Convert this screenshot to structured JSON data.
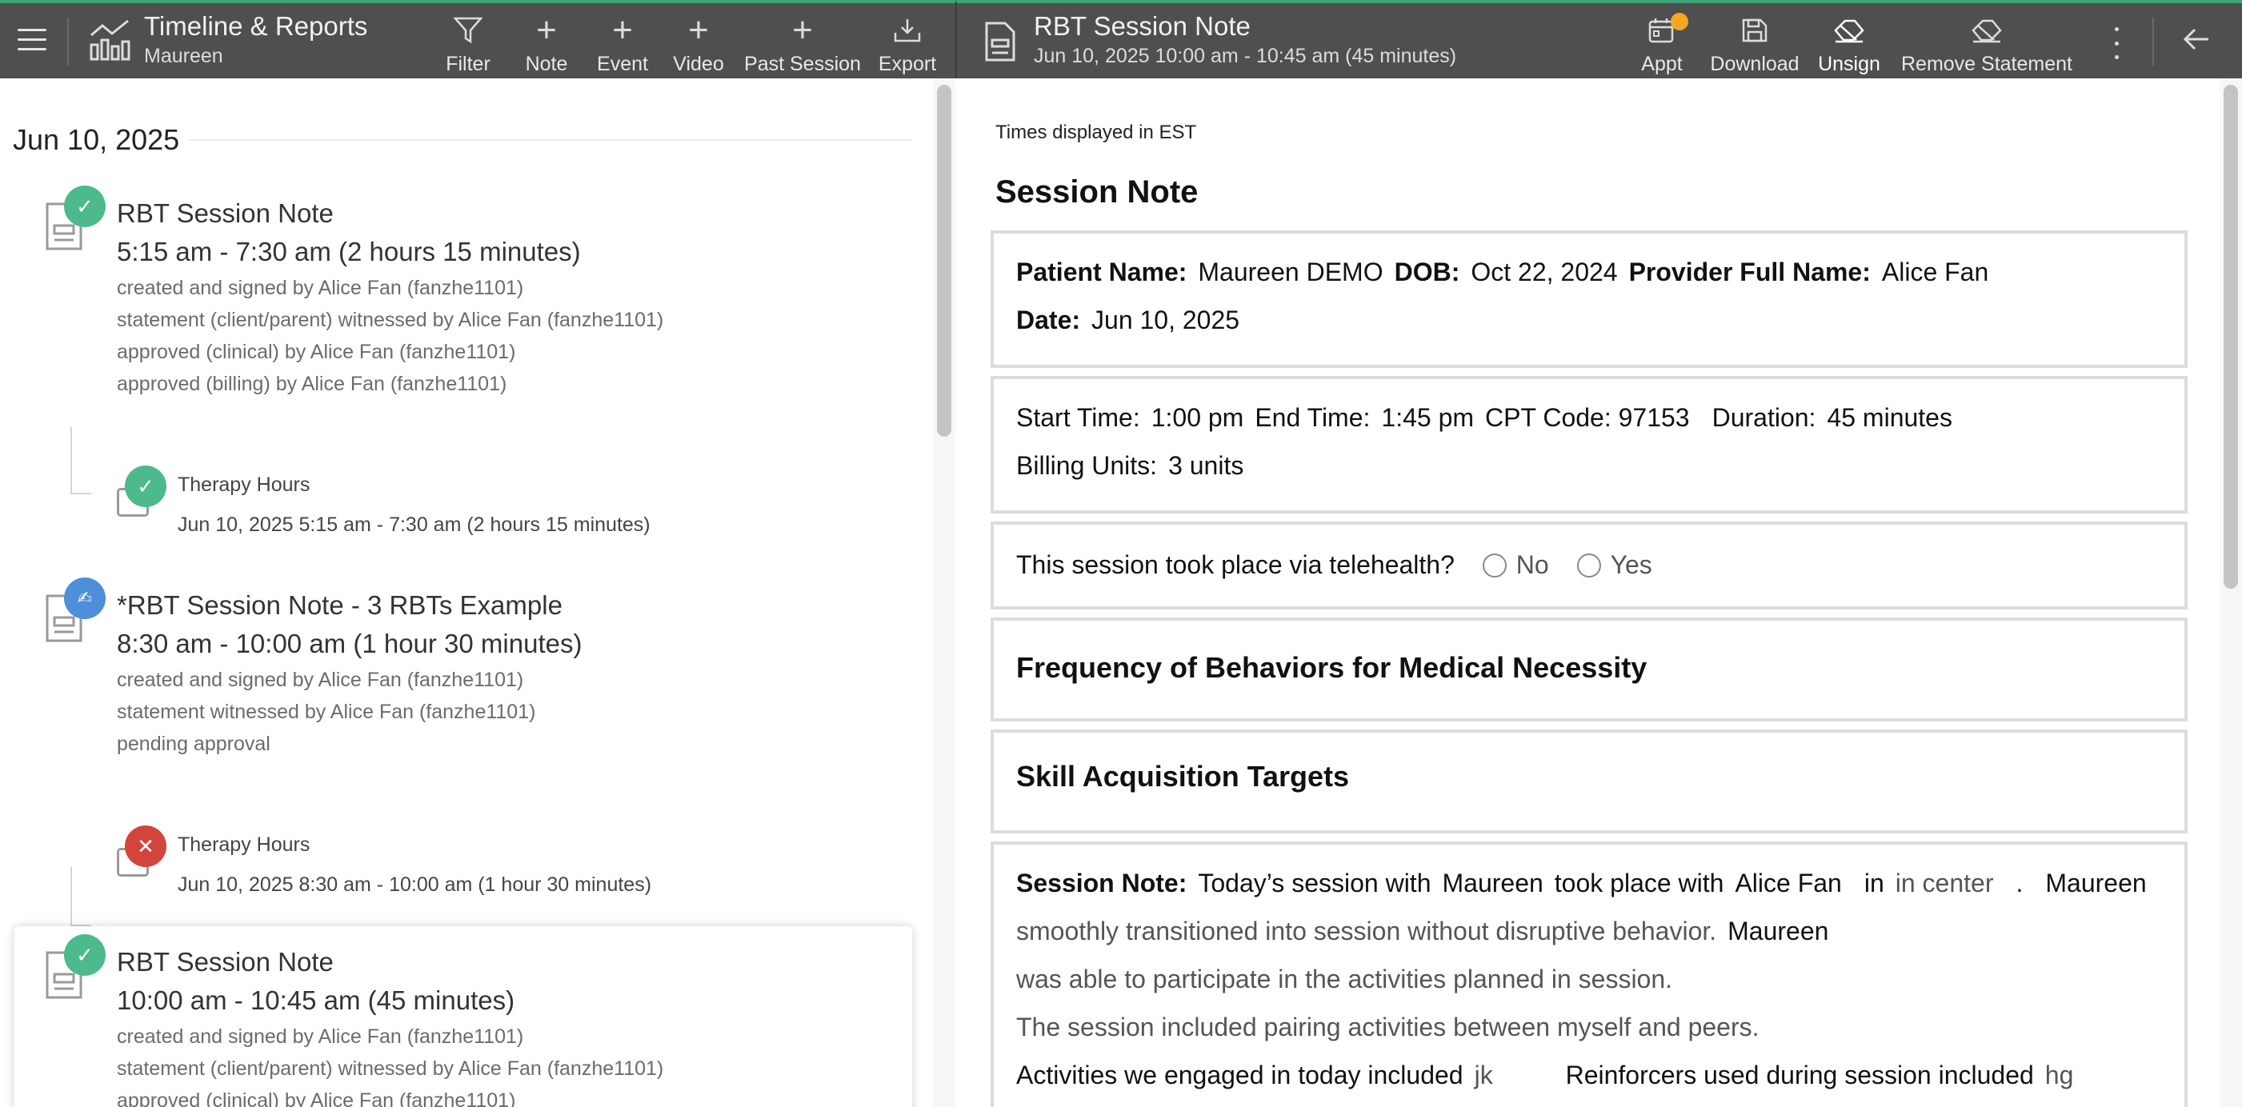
{
  "left_bar": {
    "title": "Timeline & Reports",
    "subtitle": "Maureen",
    "tools": [
      {
        "label": "Filter",
        "icon": "filter-icon"
      },
      {
        "label": "Note",
        "icon": "plus-icon"
      },
      {
        "label": "Event",
        "icon": "plus-icon"
      },
      {
        "label": "Video",
        "icon": "plus-icon"
      },
      {
        "label": "Past Session",
        "icon": "plus-icon"
      },
      {
        "label": "Export",
        "icon": "download-tray-icon"
      }
    ]
  },
  "right_bar": {
    "title": "RBT Session Note",
    "subtitle": "Jun 10, 2025 10:00 am - 10:45 am (45 minutes)",
    "tools": [
      {
        "label": "Appt",
        "icon": "calendar-icon"
      },
      {
        "label": "Download",
        "icon": "save-icon"
      },
      {
        "label": "Unsign",
        "icon": "eraser-icon"
      },
      {
        "label": "Remove Statement",
        "icon": "eraser-icon"
      }
    ],
    "colors": {
      "bar": "#4f4f4f",
      "accent": "#3fa378",
      "notification": "#f5a623"
    }
  },
  "timeline": {
    "date": "Jun 10, 2025",
    "entries": [
      {
        "title": "RBT Session Note",
        "time": "5:15 am - 7:30 am (2 hours 15 minutes)",
        "lines": [
          "created and signed by Alice Fan (fanzhe1101)",
          "statement (client/parent) witnessed by Alice Fan (fanzhe1101)",
          "approved (clinical) by Alice Fan (fanzhe1101)",
          "approved (billing) by Alice Fan (fanzhe1101)"
        ],
        "status": "approved",
        "sub": {
          "title": "Therapy Hours",
          "time": "Jun 10, 2025 5:15 am - 7:30 am (2 hours 15 minutes)",
          "status": "approved"
        }
      },
      {
        "title": "*RBT Session Note - 3 RBTs Example",
        "time": "8:30 am - 10:00 am (1 hour 30 minutes)",
        "lines": [
          "created and signed by Alice Fan (fanzhe1101)",
          "statement witnessed by Alice Fan (fanzhe1101)",
          "pending approval"
        ],
        "status": "signed",
        "sub": {
          "title": "Therapy Hours",
          "time": "Jun 10, 2025 8:30 am - 10:00 am (1 hour 30 minutes)",
          "status": "rejected"
        }
      },
      {
        "title": "RBT Session Note",
        "time": "10:00 am - 10:45 am (45 minutes)",
        "lines": [
          "created and signed by Alice Fan (fanzhe1101)",
          "statement (client/parent) witnessed by Alice Fan (fanzhe1101)",
          "approved (clinical) by Alice Fan (fanzhe1101)"
        ],
        "status": "approved"
      }
    ]
  },
  "note": {
    "timezone": "Times displayed in EST",
    "heading": "Session Note",
    "patient_label": "Patient Name:",
    "patient": "Maureen DEMO",
    "dob_label": "DOB:",
    "dob": "Oct 22, 2024",
    "provider_label": "Provider Full Name:",
    "provider": "Alice Fan",
    "date_label": "Date:",
    "date": "Jun 10, 2025",
    "start_label": "Start Time:",
    "start": "1:00 pm",
    "end_label": "End Time:",
    "end": "1:45 pm",
    "cpt": "CPT Code: 97153",
    "duration_label": "Duration:",
    "duration": "45 minutes",
    "units_label": "Billing Units:",
    "units": "3 units",
    "telehealth_q": "This session took place via telehealth?",
    "opt_no": "No",
    "opt_yes": "Yes",
    "section_freq": "Frequency of Behaviors for Medical Necessity",
    "section_skill": "Skill Acquisition Targets",
    "sn_label": "Session Note:",
    "sn_l1_a": "Today’s session with",
    "sn_name": "Maureen",
    "sn_l1_b": "took place with",
    "sn_provider": "Alice Fan",
    "sn_in": "in",
    "sn_location": "in center",
    "sn_dot": ".",
    "sn_l2": "smoothly transitioned into session without disruptive behavior.",
    "sn_l3": "was able to participate in the activities planned in session.",
    "sn_l4": "The session included pairing activities between myself and peers.",
    "sn_l5_a": "Activities we engaged in today included",
    "sn_l5_a_val": "jk",
    "sn_l5_b": "Reinforcers used during session included",
    "sn_l5_b_val": "hg"
  }
}
